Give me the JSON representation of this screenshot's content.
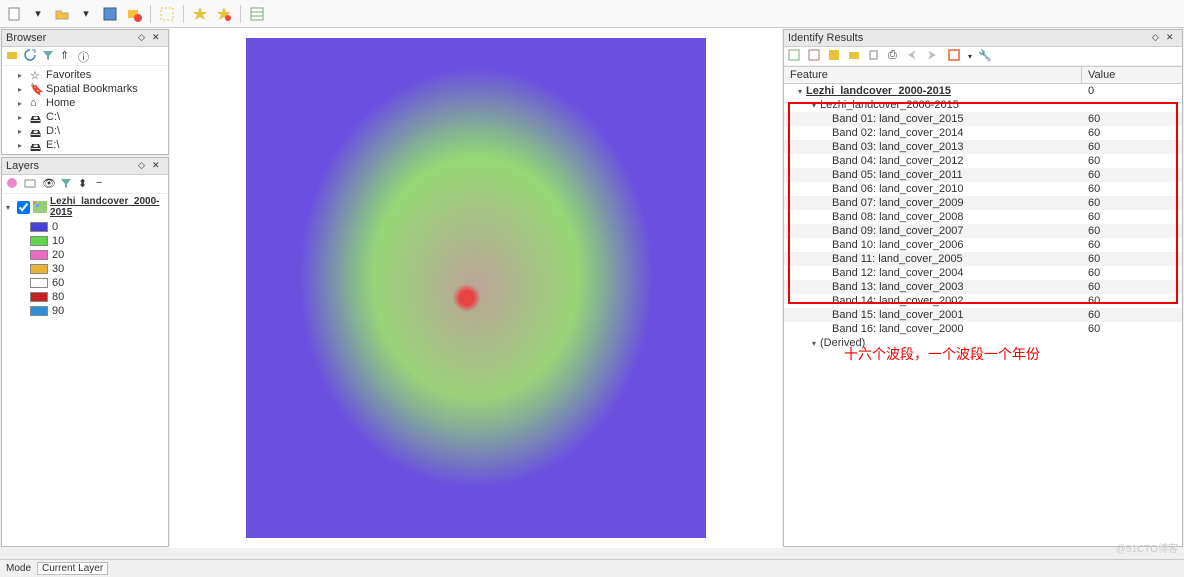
{
  "toolbar": {
    "icons": [
      "new",
      "open",
      "save",
      "remove-layer",
      "select",
      "bookmark-add",
      "bookmark-del",
      "table"
    ]
  },
  "browser": {
    "title": "Browser",
    "items": [
      {
        "icon": "star",
        "label": "Favorites"
      },
      {
        "icon": "bookmark",
        "label": "Spatial Bookmarks"
      },
      {
        "icon": "home",
        "label": "Home"
      },
      {
        "icon": "drive",
        "label": "C:\\"
      },
      {
        "icon": "drive",
        "label": "D:\\"
      },
      {
        "icon": "drive",
        "label": "E:\\"
      }
    ]
  },
  "layers": {
    "title": "Layers",
    "layer_name": "Lezhi_landcover_2000-2015",
    "legend": [
      {
        "color": "#4A3FD6",
        "label": "0"
      },
      {
        "color": "#5FD64A",
        "label": "10"
      },
      {
        "color": "#E86BC0",
        "label": "20"
      },
      {
        "color": "#E8B23A",
        "label": "30"
      },
      {
        "color": "#FFFFFF",
        "label": "60"
      },
      {
        "color": "#C92020",
        "label": "80"
      },
      {
        "color": "#2F8FD6",
        "label": "90"
      }
    ]
  },
  "identify": {
    "title": "Identify Results",
    "col_feature": "Feature",
    "col_value": "Value",
    "root": {
      "label": "Lezhi_landcover_2000-2015",
      "value": "0"
    },
    "group": "Lezhi_landcover_2000-2015",
    "bands": [
      {
        "label": "Band 01: land_cover_2015",
        "value": "60"
      },
      {
        "label": "Band 02: land_cover_2014",
        "value": "60"
      },
      {
        "label": "Band 03: land_cover_2013",
        "value": "60"
      },
      {
        "label": "Band 04: land_cover_2012",
        "value": "60"
      },
      {
        "label": "Band 05: land_cover_2011",
        "value": "60"
      },
      {
        "label": "Band 06: land_cover_2010",
        "value": "60"
      },
      {
        "label": "Band 07: land_cover_2009",
        "value": "60"
      },
      {
        "label": "Band 08: land_cover_2008",
        "value": "60"
      },
      {
        "label": "Band 09: land_cover_2007",
        "value": "60"
      },
      {
        "label": "Band 10: land_cover_2006",
        "value": "60"
      },
      {
        "label": "Band 11: land_cover_2005",
        "value": "60"
      },
      {
        "label": "Band 12: land_cover_2004",
        "value": "60"
      },
      {
        "label": "Band 13: land_cover_2003",
        "value": "60"
      },
      {
        "label": "Band 14: land_cover_2002",
        "value": "60"
      },
      {
        "label": "Band 15: land_cover_2001",
        "value": "60"
      },
      {
        "label": "Band 16: land_cover_2000",
        "value": "60"
      }
    ],
    "derived": "(Derived)"
  },
  "annotation": "十六个波段，一个波段一个年份",
  "status": {
    "mode_label": "Mode",
    "mode_value": "Current Layer"
  },
  "watermark": "@51CTO博客"
}
